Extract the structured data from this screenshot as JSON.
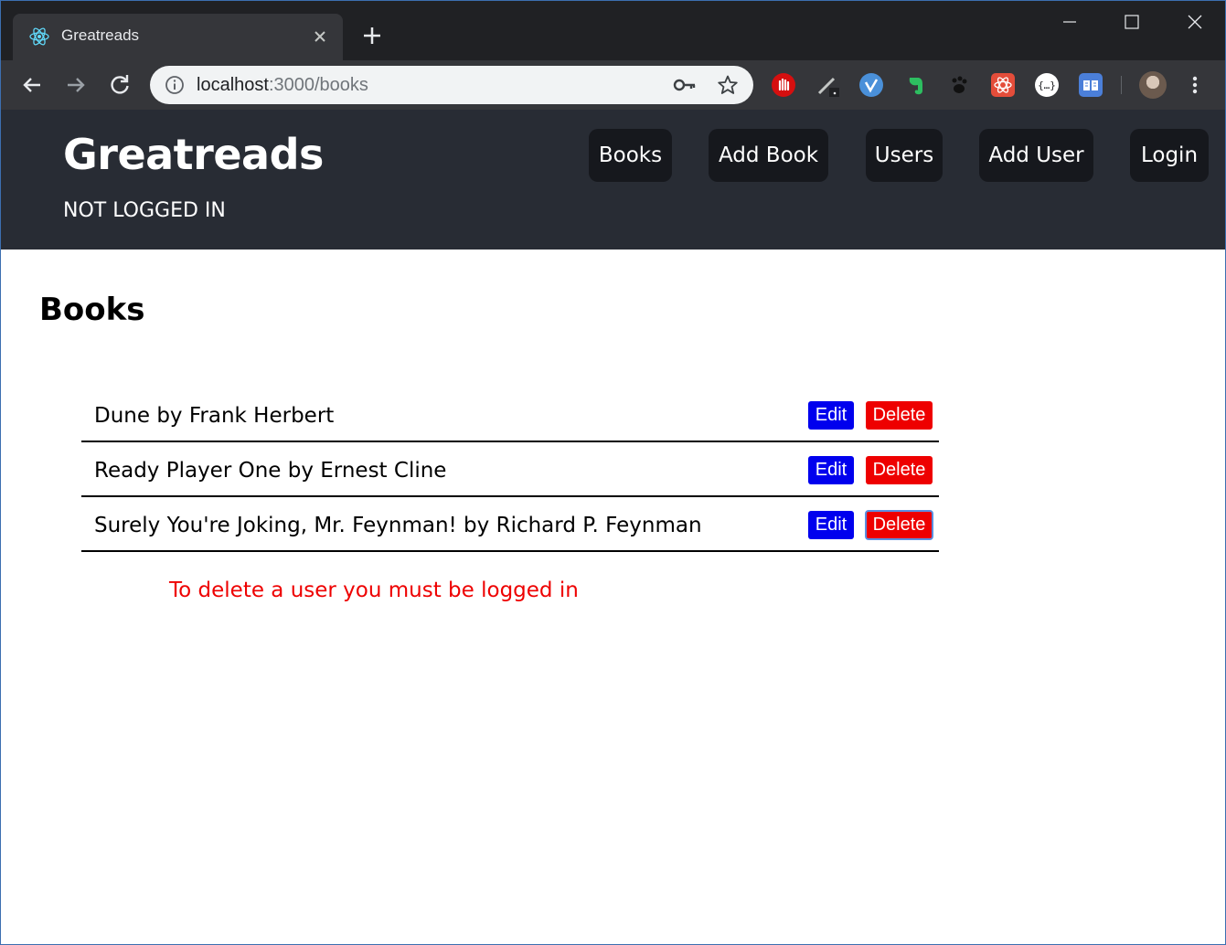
{
  "browser": {
    "tab_title": "Greatreads",
    "url_host": "localhost",
    "url_path": ":3000/books",
    "icons": [
      "react-favicon-icon",
      "close-icon",
      "plus-icon",
      "back-icon",
      "forward-icon",
      "reload-icon",
      "info-icon",
      "key-icon",
      "star-icon",
      "kebab-menu-icon"
    ]
  },
  "header": {
    "brand": "Greatreads",
    "login_status": "NOT LOGGED IN",
    "nav": [
      {
        "label": "Books"
      },
      {
        "label": "Add Book"
      },
      {
        "label": "Users"
      },
      {
        "label": "Add User"
      },
      {
        "label": "Login"
      }
    ]
  },
  "main": {
    "title": "Books",
    "books": [
      {
        "text": "Dune by Frank Herbert",
        "edit_label": "Edit",
        "delete_label": "Delete"
      },
      {
        "text": "Ready Player One by Ernest Cline",
        "edit_label": "Edit",
        "delete_label": "Delete"
      },
      {
        "text": "Surely You're Joking, Mr. Feynman! by Richard P. Feynman",
        "edit_label": "Edit",
        "delete_label": "Delete"
      }
    ],
    "error_message": "To delete a user you must be logged in"
  },
  "colors": {
    "header_bg": "#282c34",
    "nav_button_bg": "#16181d",
    "edit_button": "#0000ee",
    "delete_button": "#ee0000",
    "error_text": "#ee0000"
  }
}
